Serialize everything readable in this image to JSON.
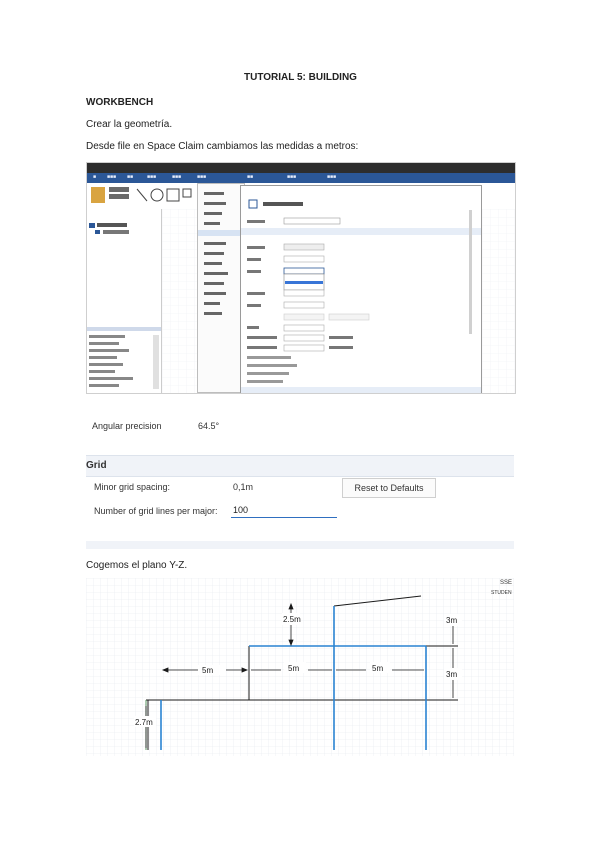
{
  "doc": {
    "title": "TUTORIAL 5: BUILDING",
    "section": "WORKBENCH",
    "p1": "Crear la geometría.",
    "p2": "Desde file en Space Claim cambiamos las medidas a metros:",
    "p3": "Cogemos el plano Y-Z."
  },
  "options_panel": {
    "angular_label": "Angular precision",
    "angular_value": "64.5°",
    "grid_header": "Grid",
    "minor_label": "Minor grid spacing:",
    "minor_value": "0,1m",
    "reset_label": "Reset to Defaults",
    "lines_label": "Number of grid lines per major:",
    "lines_value": "100"
  },
  "sketch": {
    "dims": {
      "d_top": "2.5m",
      "d_left": "5m",
      "d_mid": "5m",
      "d_right": "5m",
      "d_h1": "3m",
      "d_h2": "3m",
      "d_base": "2.7m"
    },
    "watermark": "SSE",
    "watermark2": "STUDEN"
  },
  "colors": {
    "sketch_blue": "#2a84d2",
    "sketch_dark": "#1a1a1a",
    "sketch_green": "#2f7a3a",
    "grid": "#e4e8ee",
    "ribbon_blue": "#2b5797"
  }
}
